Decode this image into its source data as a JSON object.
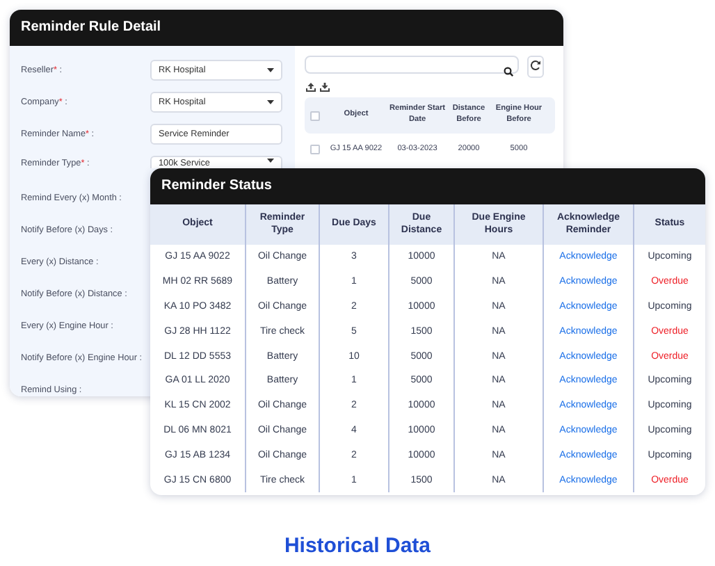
{
  "rule_window": {
    "title": "Reminder Rule Detail",
    "form": [
      {
        "label": "Reseller",
        "required": true,
        "mark": "*",
        "colon": ":",
        "field": {
          "kind": "dropdown",
          "value": "RK Hospital"
        }
      },
      {
        "label": "Company",
        "required": true,
        "mark": "*",
        "colon": ":",
        "field": {
          "kind": "dropdown",
          "value": "RK Hospital"
        }
      },
      {
        "label": "Reminder Name",
        "required": true,
        "mark": "*",
        "colon": ":",
        "field": {
          "kind": "text",
          "value": "Service Reminder"
        }
      },
      {
        "label": "Reminder Type",
        "required": true,
        "mark": "*",
        "colon": ":",
        "field": {
          "kind": "dropdown",
          "value": "100k Service"
        }
      },
      {
        "label": "Remind Every (x) Month :",
        "required": false
      },
      {
        "label": "Notify Before (x) Days :",
        "required": false
      },
      {
        "label": "Every (x) Distance :",
        "required": false
      },
      {
        "label": "Notify Before (x) Distance :",
        "required": false
      },
      {
        "label": "Every (x) Engine Hour :",
        "required": false
      },
      {
        "label": "Notify Before (x) Engine Hour :",
        "required": false
      },
      {
        "label": "Remind Using :",
        "required": false
      }
    ],
    "table": {
      "columns": [
        "Object",
        "Reminder Start Date",
        "Distance Before",
        "Engine Hour Before"
      ],
      "rows": [
        {
          "checked": false,
          "cells": [
            "GJ 15 AA 9022",
            "03-03-2023",
            "20000",
            "5000"
          ]
        }
      ],
      "header_checked": false
    }
  },
  "status_window": {
    "title": "Reminder Status",
    "columns": [
      "Object",
      "Reminder Type",
      "Due Days",
      "Due Distance",
      "Due Engine Hours",
      "Acknowledge Reminder",
      "Status"
    ],
    "rows": [
      {
        "object": "GJ 15 AA 9022",
        "type": "Oil Change",
        "due_days": "3",
        "due_distance": "10000",
        "due_engine_hours": "NA",
        "action": "Acknowledge",
        "status": "Upcoming",
        "overdue": false
      },
      {
        "object": "MH 02 RR 5689",
        "type": "Battery",
        "due_days": "1",
        "due_distance": "5000",
        "due_engine_hours": "NA",
        "action": "Acknowledge",
        "status": "Overdue",
        "overdue": true
      },
      {
        "object": "KA 10 PO 3482",
        "type": "Oil Change",
        "due_days": "2",
        "due_distance": "10000",
        "due_engine_hours": "NA",
        "action": "Acknowledge",
        "status": "Upcoming",
        "overdue": false
      },
      {
        "object": "GJ 28 HH 1122",
        "type": "Tire check",
        "due_days": "5",
        "due_distance": "1500",
        "due_engine_hours": "NA",
        "action": "Acknowledge",
        "status": "Overdue",
        "overdue": true
      },
      {
        "object": "DL 12 DD 5553",
        "type": "Battery",
        "due_days": "10",
        "due_distance": "5000",
        "due_engine_hours": "NA",
        "action": "Acknowledge",
        "status": "Overdue",
        "overdue": true
      },
      {
        "object": "GA 01 LL 2020",
        "type": "Battery",
        "due_days": "1",
        "due_distance": "5000",
        "due_engine_hours": "NA",
        "action": "Acknowledge",
        "status": "Upcoming",
        "overdue": false
      },
      {
        "object": "KL 15 CN 2002",
        "type": "Oil Change",
        "due_days": "2",
        "due_distance": "10000",
        "due_engine_hours": "NA",
        "action": "Acknowledge",
        "status": "Upcoming",
        "overdue": false
      },
      {
        "object": "DL 06 MN 8021",
        "type": "Oil Change",
        "due_days": "4",
        "due_distance": "10000",
        "due_engine_hours": "NA",
        "action": "Acknowledge",
        "status": "Upcoming",
        "overdue": false
      },
      {
        "object": "GJ 15 AB 1234",
        "type": "Oil Change",
        "due_days": "2",
        "due_distance": "10000",
        "due_engine_hours": "NA",
        "action": "Acknowledge",
        "status": "Upcoming",
        "overdue": false
      },
      {
        "object": "GJ 15 CN 6800",
        "type": "Tire check",
        "due_days": "1",
        "due_distance": "1500",
        "due_engine_hours": "NA",
        "action": "Acknowledge",
        "status": "Overdue",
        "overdue": true
      }
    ]
  },
  "caption": "Historical Data"
}
